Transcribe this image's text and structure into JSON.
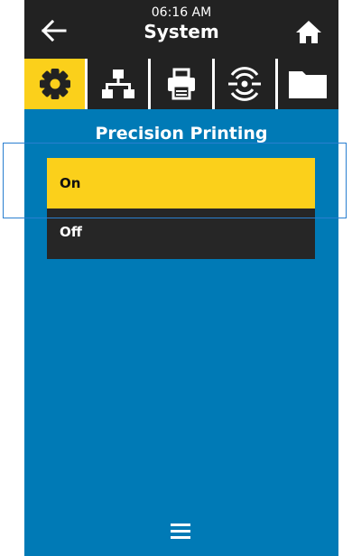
{
  "header": {
    "time": "06:16 AM",
    "title": "System",
    "back_icon": "arrow-left-icon",
    "home_icon": "home-icon"
  },
  "tabs": [
    {
      "icon": "gear-icon",
      "active": true
    },
    {
      "icon": "network-icon",
      "active": false
    },
    {
      "icon": "printer-icon",
      "active": false
    },
    {
      "icon": "wireless-icon",
      "active": false
    },
    {
      "icon": "folder-icon",
      "active": false
    }
  ],
  "main": {
    "section_title": "Precision Printing",
    "options": [
      {
        "label": "On",
        "selected": true
      },
      {
        "label": "Off",
        "selected": false
      }
    ]
  },
  "footer": {
    "menu_icon": "hamburger-menu-icon"
  },
  "colors": {
    "accent": "#fbd01b",
    "background": "#007ab6",
    "header": "#222222",
    "option_dark": "#262626"
  }
}
